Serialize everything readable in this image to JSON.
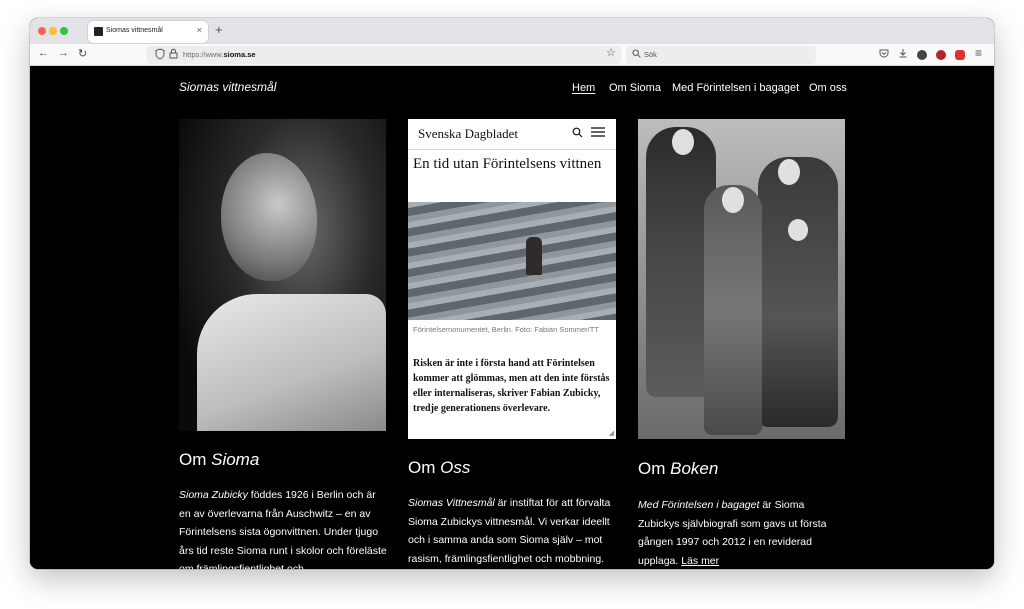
{
  "browser": {
    "tab_title": "Siomas vittnesmål",
    "tab_close": "×",
    "new_tab": "+",
    "url_prefix": "https://www.",
    "url_domain": "sioma.se",
    "search_placeholder": "Sök",
    "icons": {
      "back": "←",
      "forward": "→",
      "reload": "↻",
      "star": "☆",
      "menu": "≡"
    }
  },
  "site": {
    "title": "Siomas vittnesmål",
    "nav": [
      {
        "label": "Hem",
        "active": true
      },
      {
        "label": "Om Sioma",
        "active": false
      },
      {
        "label": "Med Förintelsen i bagaget",
        "active": false
      },
      {
        "label": "Om oss",
        "active": false
      }
    ]
  },
  "article_card": {
    "brand": "Svenska Dagbladet",
    "headline": "En tid utan Förintelsens vittnen",
    "caption": "Förintelsemonumentet, Berlin. Foto: Fabian Sommer/TT",
    "lead": "Risken är inte i första hand att Förintelsen kommer att glömmas, men att den inte förstås eller internaliseras, skriver Fabian Zubicky, tredje generationens överlevare."
  },
  "columns": [
    {
      "title_plain": "Om ",
      "title_italic": "Sioma",
      "text_italic": "Sioma Zubicky",
      "text": " föddes 1926 i Berlin och är en av överlevarna från Auschwitz – en av Förintelsens sista ögonvittnen. Under tjugo års tid reste Sioma runt i skolor och föreläste om främlingsfientlighet och"
    },
    {
      "title_plain": "Om ",
      "title_italic": "Oss",
      "text_italic": "Siomas Vittnesmål",
      "text": " är instiftat för att förvalta Sioma Zubickys vittnesmål. Vi verkar ideellt och i samma anda som Sioma själv – mot rasism, främlingsfientlighet och mobbning."
    },
    {
      "title_plain": "Om ",
      "title_italic": "Boken",
      "text_italic": "Med Förintelsen i bagaget",
      "text": " är Sioma Zubickys självbiografi som gavs ut första gången 1997 och 2012 i en reviderad upplaga. ",
      "link": "Läs mer"
    }
  ],
  "colors": {
    "page_bg": "#000000",
    "text": "#ffffff",
    "chrome": "#e3e2e7"
  }
}
